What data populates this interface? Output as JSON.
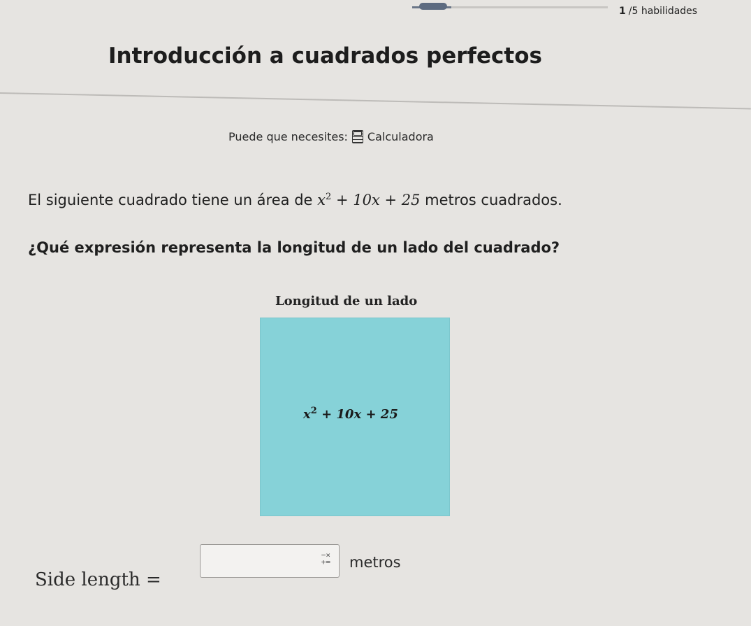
{
  "progress": {
    "current": "1",
    "total_text": "/5 habilidades",
    "fraction": 0.2
  },
  "title": "Introducción a cuadrados perfectos",
  "hint": {
    "prefix": "Puede que necesites:",
    "tool_icon": "calculator-icon",
    "tool_label": "Calculadora"
  },
  "statement": {
    "before": "El siguiente cuadrado tiene un área de",
    "expr_var": "x",
    "expr_exp": "2",
    "expr_rest": "+ 10x + 25",
    "after": "metros cuadrados."
  },
  "question": "¿Qué expresión representa la longitud de un lado del cuadrado?",
  "figure": {
    "label": "Longitud de un lado",
    "square_color": "#86d2d8",
    "area_var": "x",
    "area_exp": "2",
    "area_rest": "+ 10x + 25"
  },
  "answer": {
    "label": "Side length =",
    "value": "",
    "keypad_icon": "math-keypad-icon",
    "units": "metros"
  }
}
